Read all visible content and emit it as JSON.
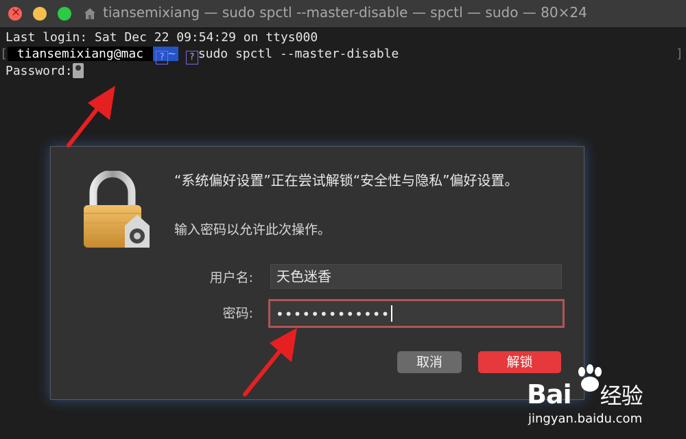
{
  "window": {
    "title": "tiansemixiang — sudo spctl --master-disable — spctl — sudo — 80×24"
  },
  "terminal": {
    "last_login": "Last login: Sat Dec 22 09:54:29 on ttys000",
    "prompt_user": "tiansemixiang@mac",
    "prompt_dir": "~",
    "prompt_glyph": "?",
    "command": "sudo spctl --master-disable",
    "password_prompt": "Password:"
  },
  "dialog": {
    "message": "“系统偏好设置”正在尝试解锁“安全性与隐私”偏好设置。",
    "sub_message": "输入密码以允许此次操作。",
    "username_label": "用户名:",
    "username_value": "天色迷香",
    "password_label": "密码:",
    "password_value": "•••••••••••••",
    "cancel_label": "取消",
    "unlock_label": "解锁"
  },
  "watermark": {
    "brand": "Bai",
    "brand_cn": "经验",
    "url": "jingyan.baidu.com"
  },
  "colors": {
    "accent_unlock": "#e5393b",
    "arrow": "#e62020",
    "field_focus_border": "#b25454"
  }
}
